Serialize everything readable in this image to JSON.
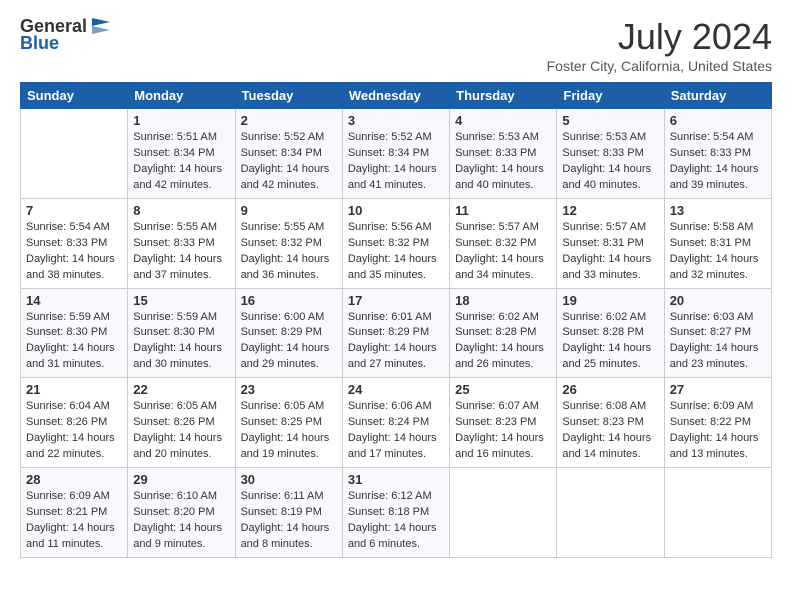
{
  "header": {
    "logo_general": "General",
    "logo_blue": "Blue",
    "title": "July 2024",
    "location": "Foster City, California, United States"
  },
  "weekdays": [
    "Sunday",
    "Monday",
    "Tuesday",
    "Wednesday",
    "Thursday",
    "Friday",
    "Saturday"
  ],
  "weeks": [
    [
      {
        "day": "",
        "info": ""
      },
      {
        "day": "1",
        "info": "Sunrise: 5:51 AM\nSunset: 8:34 PM\nDaylight: 14 hours\nand 42 minutes."
      },
      {
        "day": "2",
        "info": "Sunrise: 5:52 AM\nSunset: 8:34 PM\nDaylight: 14 hours\nand 42 minutes."
      },
      {
        "day": "3",
        "info": "Sunrise: 5:52 AM\nSunset: 8:34 PM\nDaylight: 14 hours\nand 41 minutes."
      },
      {
        "day": "4",
        "info": "Sunrise: 5:53 AM\nSunset: 8:33 PM\nDaylight: 14 hours\nand 40 minutes."
      },
      {
        "day": "5",
        "info": "Sunrise: 5:53 AM\nSunset: 8:33 PM\nDaylight: 14 hours\nand 40 minutes."
      },
      {
        "day": "6",
        "info": "Sunrise: 5:54 AM\nSunset: 8:33 PM\nDaylight: 14 hours\nand 39 minutes."
      }
    ],
    [
      {
        "day": "7",
        "info": "Sunrise: 5:54 AM\nSunset: 8:33 PM\nDaylight: 14 hours\nand 38 minutes."
      },
      {
        "day": "8",
        "info": "Sunrise: 5:55 AM\nSunset: 8:33 PM\nDaylight: 14 hours\nand 37 minutes."
      },
      {
        "day": "9",
        "info": "Sunrise: 5:55 AM\nSunset: 8:32 PM\nDaylight: 14 hours\nand 36 minutes."
      },
      {
        "day": "10",
        "info": "Sunrise: 5:56 AM\nSunset: 8:32 PM\nDaylight: 14 hours\nand 35 minutes."
      },
      {
        "day": "11",
        "info": "Sunrise: 5:57 AM\nSunset: 8:32 PM\nDaylight: 14 hours\nand 34 minutes."
      },
      {
        "day": "12",
        "info": "Sunrise: 5:57 AM\nSunset: 8:31 PM\nDaylight: 14 hours\nand 33 minutes."
      },
      {
        "day": "13",
        "info": "Sunrise: 5:58 AM\nSunset: 8:31 PM\nDaylight: 14 hours\nand 32 minutes."
      }
    ],
    [
      {
        "day": "14",
        "info": "Sunrise: 5:59 AM\nSunset: 8:30 PM\nDaylight: 14 hours\nand 31 minutes."
      },
      {
        "day": "15",
        "info": "Sunrise: 5:59 AM\nSunset: 8:30 PM\nDaylight: 14 hours\nand 30 minutes."
      },
      {
        "day": "16",
        "info": "Sunrise: 6:00 AM\nSunset: 8:29 PM\nDaylight: 14 hours\nand 29 minutes."
      },
      {
        "day": "17",
        "info": "Sunrise: 6:01 AM\nSunset: 8:29 PM\nDaylight: 14 hours\nand 27 minutes."
      },
      {
        "day": "18",
        "info": "Sunrise: 6:02 AM\nSunset: 8:28 PM\nDaylight: 14 hours\nand 26 minutes."
      },
      {
        "day": "19",
        "info": "Sunrise: 6:02 AM\nSunset: 8:28 PM\nDaylight: 14 hours\nand 25 minutes."
      },
      {
        "day": "20",
        "info": "Sunrise: 6:03 AM\nSunset: 8:27 PM\nDaylight: 14 hours\nand 23 minutes."
      }
    ],
    [
      {
        "day": "21",
        "info": "Sunrise: 6:04 AM\nSunset: 8:26 PM\nDaylight: 14 hours\nand 22 minutes."
      },
      {
        "day": "22",
        "info": "Sunrise: 6:05 AM\nSunset: 8:26 PM\nDaylight: 14 hours\nand 20 minutes."
      },
      {
        "day": "23",
        "info": "Sunrise: 6:05 AM\nSunset: 8:25 PM\nDaylight: 14 hours\nand 19 minutes."
      },
      {
        "day": "24",
        "info": "Sunrise: 6:06 AM\nSunset: 8:24 PM\nDaylight: 14 hours\nand 17 minutes."
      },
      {
        "day": "25",
        "info": "Sunrise: 6:07 AM\nSunset: 8:23 PM\nDaylight: 14 hours\nand 16 minutes."
      },
      {
        "day": "26",
        "info": "Sunrise: 6:08 AM\nSunset: 8:23 PM\nDaylight: 14 hours\nand 14 minutes."
      },
      {
        "day": "27",
        "info": "Sunrise: 6:09 AM\nSunset: 8:22 PM\nDaylight: 14 hours\nand 13 minutes."
      }
    ],
    [
      {
        "day": "28",
        "info": "Sunrise: 6:09 AM\nSunset: 8:21 PM\nDaylight: 14 hours\nand 11 minutes."
      },
      {
        "day": "29",
        "info": "Sunrise: 6:10 AM\nSunset: 8:20 PM\nDaylight: 14 hours\nand 9 minutes."
      },
      {
        "day": "30",
        "info": "Sunrise: 6:11 AM\nSunset: 8:19 PM\nDaylight: 14 hours\nand 8 minutes."
      },
      {
        "day": "31",
        "info": "Sunrise: 6:12 AM\nSunset: 8:18 PM\nDaylight: 14 hours\nand 6 minutes."
      },
      {
        "day": "",
        "info": ""
      },
      {
        "day": "",
        "info": ""
      },
      {
        "day": "",
        "info": ""
      }
    ]
  ]
}
